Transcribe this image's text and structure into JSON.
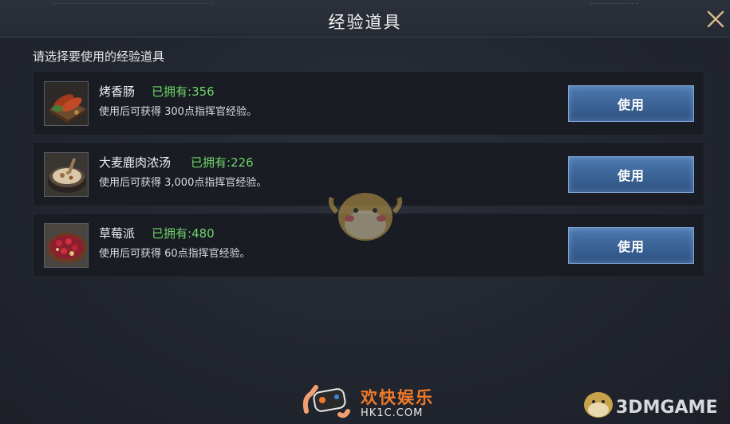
{
  "dialog": {
    "title": "经验道具",
    "subtitle": "请选择要使用的经验道具"
  },
  "items": [
    {
      "name": "烤香肠",
      "owned_label": "已拥有:",
      "owned_count": "356",
      "description": "使用后可获得 300点指挥官经验。",
      "button_label": "使用",
      "icon": "grilled-sausage-icon"
    },
    {
      "name": "大麦鹿肉浓汤",
      "owned_label": "已拥有:",
      "owned_count": "226",
      "description": "使用后可获得 3,000点指挥官经验。",
      "button_label": "使用",
      "icon": "venison-soup-icon"
    },
    {
      "name": "草莓派",
      "owned_label": "已拥有:",
      "owned_count": "480",
      "description": "使用后可获得 60点指挥官经验。",
      "button_label": "使用",
      "icon": "strawberry-pie-icon"
    }
  ],
  "watermark": {
    "brand1": "欢快娱乐",
    "url1": "HK1C.COM",
    "brand2": "3DMGAME"
  },
  "colors": {
    "owned_green": "#6fd46a",
    "button_blue": "#3d6699",
    "panel_bg": "#20242d",
    "row_bg": "#191c23",
    "watermark_orange": "#f07a2a"
  }
}
